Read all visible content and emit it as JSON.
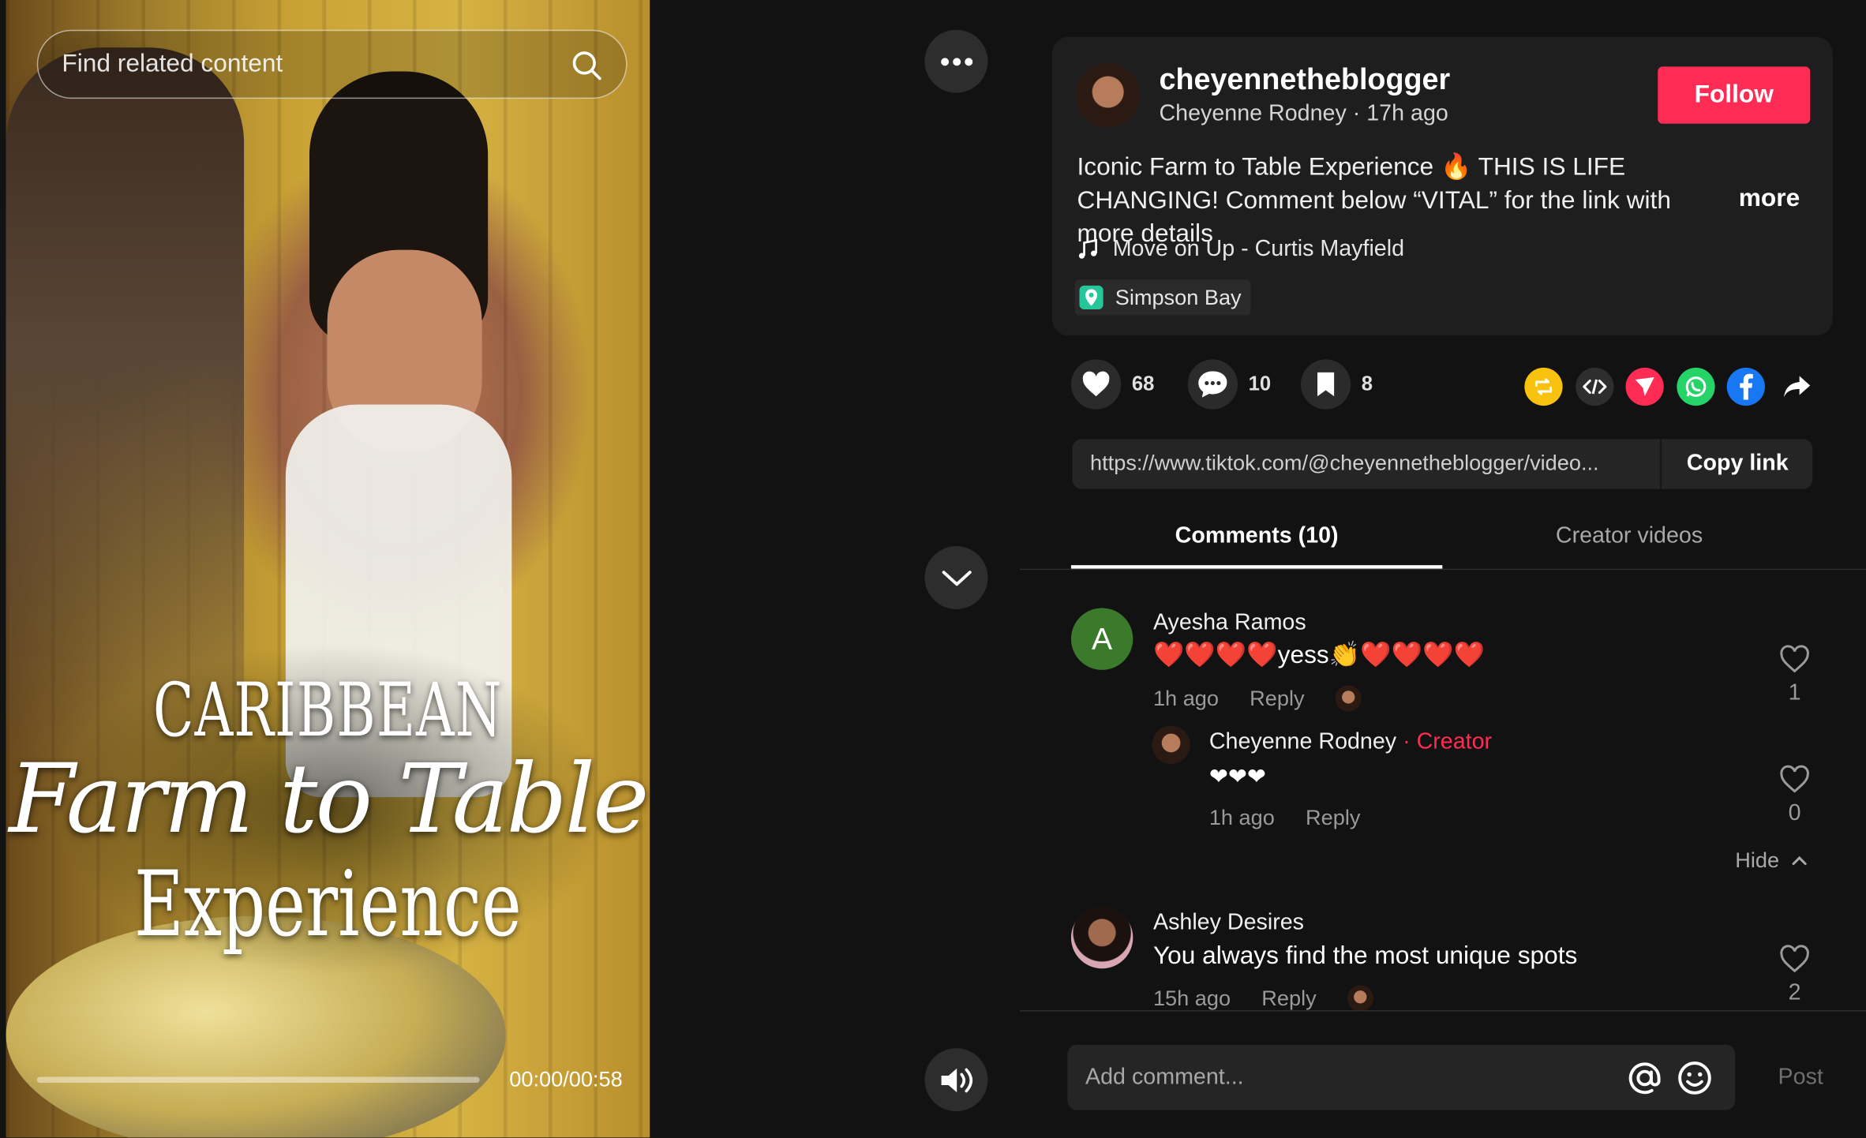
{
  "video": {
    "search_placeholder": "Find related content",
    "overlay_title": [
      "CARIBBEAN",
      "Farm to Table",
      "Experience"
    ],
    "timecode": "00:00/00:58",
    "progress_fraction": 0.0
  },
  "post": {
    "username": "cheyennetheblogger",
    "display_name_time": "Cheyenne Rodney · 17h ago",
    "follow_label": "Follow",
    "caption": "Iconic Farm to Table Experience 🔥 THIS IS LIFE CHANGING! Comment below “VITAL” for the link with more details",
    "more_label": "more",
    "music": "Move on Up - Curtis Mayfield",
    "location": "Simpson Bay"
  },
  "actions": {
    "likes": "68",
    "comments": "10",
    "saves": "8"
  },
  "share_icons": [
    "repost-icon",
    "embed-icon",
    "send-icon",
    "whatsapp-icon",
    "facebook-icon",
    "share-arrow-icon"
  ],
  "link": {
    "url": "https://www.tiktok.com/@cheyennetheblogger/video...",
    "copy_label": "Copy link"
  },
  "tabs": {
    "comments": "Comments (10)",
    "creator_videos": "Creator videos"
  },
  "comments": [
    {
      "name": "Ayesha Ramos",
      "initial": "A",
      "text": "❤️❤️❤️❤️yess👏❤️❤️❤️❤️",
      "time": "1h ago",
      "reply_label": "Reply",
      "likes": "1",
      "reply": {
        "name": "Cheyenne Rodney",
        "tag": " · Creator",
        "text": "❤❤❤",
        "time": "1h ago",
        "reply_label": "Reply",
        "likes": "0"
      }
    },
    {
      "name": "Ashley Desires",
      "text": "You always find the most unique spots",
      "time": "15h ago",
      "reply_label": "Reply",
      "likes": "2"
    }
  ],
  "hide_label": "Hide",
  "composer": {
    "placeholder": "Add comment...",
    "post_label": "Post"
  },
  "colors": {
    "accent": "#fe2c55",
    "background": "#121212",
    "card": "#1e1e1e"
  }
}
